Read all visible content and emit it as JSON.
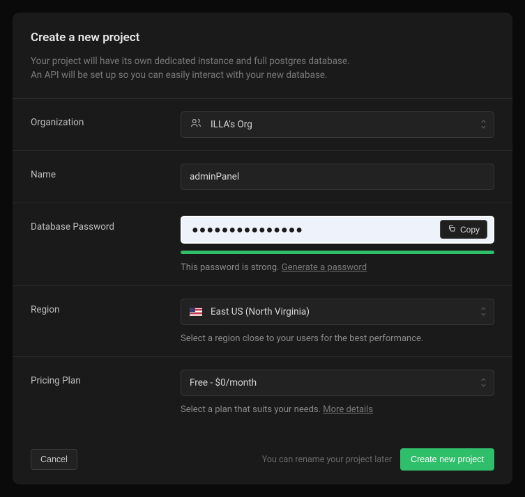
{
  "header": {
    "title": "Create a new project",
    "subtitle_line1": "Your project will have its own dedicated instance and full postgres database.",
    "subtitle_line2": "An API will be set up so you can easily interact with your new database."
  },
  "fields": {
    "organization": {
      "label": "Organization",
      "value": "ILLA's Org"
    },
    "name": {
      "label": "Name",
      "value": "adminPanel"
    },
    "password": {
      "label": "Database Password",
      "masked": "●●●●●●●●●●●●●●●",
      "copy_label": "Copy",
      "strength_text": "This password is strong.",
      "generate_link": "Generate a password",
      "strength_color": "#2fbe6a"
    },
    "region": {
      "label": "Region",
      "value": "East US (North Virginia)",
      "helper": "Select a region close to your users for the best performance."
    },
    "plan": {
      "label": "Pricing Plan",
      "value": "Free - $0/month",
      "helper_prefix": "Select a plan that suits your needs. ",
      "helper_link": "More details"
    }
  },
  "footer": {
    "cancel": "Cancel",
    "rename_hint": "You can rename your project later",
    "create": "Create new project"
  }
}
